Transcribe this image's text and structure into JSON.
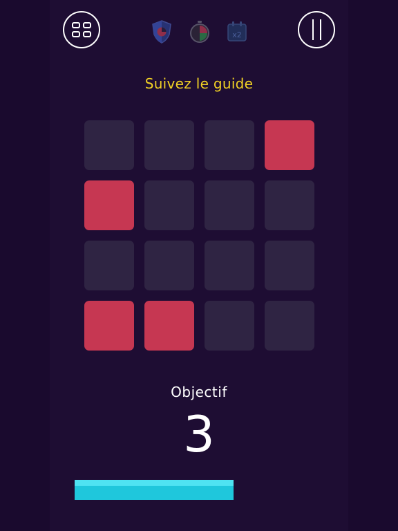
{
  "header": {
    "menu_icon": "grid-icon",
    "pause_icon": "pause-icon",
    "powerups": [
      {
        "name": "shield-powerup",
        "icon": "shield-icon"
      },
      {
        "name": "timer-powerup",
        "icon": "stopwatch-icon"
      },
      {
        "name": "double-powerup",
        "icon": "calendar-x2-icon",
        "label": "x2"
      }
    ]
  },
  "instruction": "Suivez le guide",
  "board": {
    "rows": 4,
    "cols": 4,
    "lit_tiles": [
      [
        0,
        3
      ],
      [
        1,
        0
      ],
      [
        3,
        0
      ],
      [
        3,
        1
      ]
    ],
    "colors": {
      "off": "#2f2443",
      "on": "#c63752"
    }
  },
  "objective": {
    "label": "Objectif",
    "value": "3"
  },
  "progress": {
    "fraction": 0.64,
    "color": "#1fc7dc"
  },
  "colors": {
    "background": "#1a0a2e",
    "accent_yellow": "#f2d224"
  }
}
